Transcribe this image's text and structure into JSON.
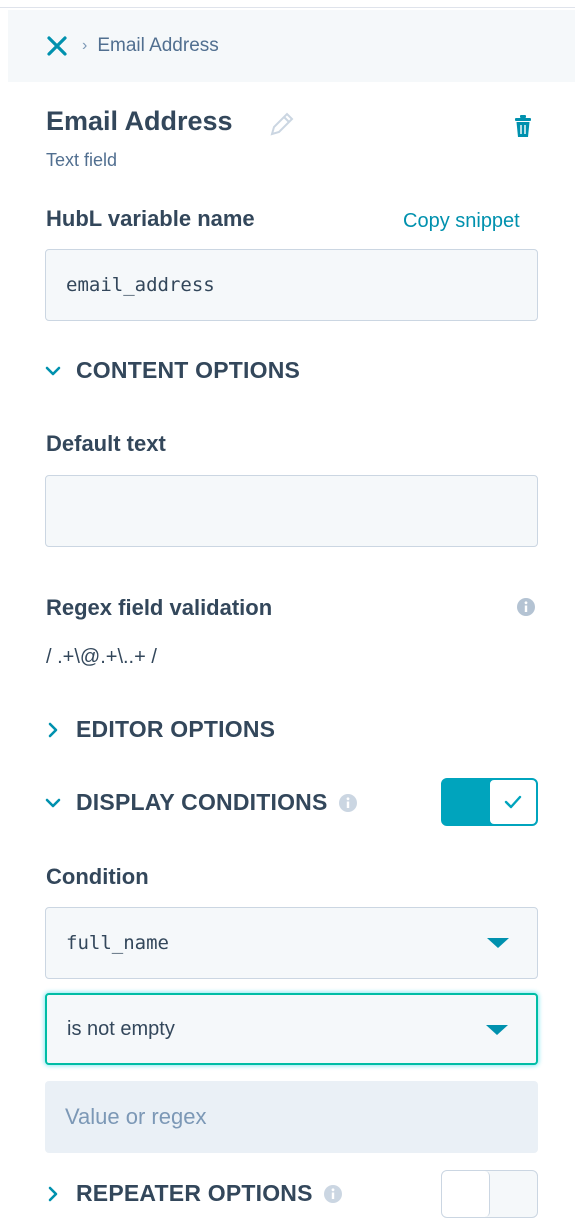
{
  "breadcrumb": {
    "current": "Email Address"
  },
  "header": {
    "title": "Email Address",
    "subtitle": "Text field"
  },
  "hubl": {
    "label": "HubL variable name",
    "copy_link": "Copy snippet",
    "value": "email_address"
  },
  "content_options": {
    "heading": "CONTENT OPTIONS",
    "default_text_label": "Default text",
    "default_text_value": "",
    "regex_label": "Regex field validation",
    "regex_value": "/ .+\\@.+\\..+ /"
  },
  "editor_options": {
    "heading": "EDITOR OPTIONS"
  },
  "display_conditions": {
    "heading": "DISPLAY CONDITIONS",
    "enabled": true,
    "condition_label": "Condition",
    "field": "full_name",
    "operator": "is not empty",
    "value_placeholder": "Value or regex"
  },
  "repeater_options": {
    "heading": "REPEATER OPTIONS",
    "enabled": false
  },
  "colors": {
    "accent": "#00a4bd",
    "link": "#0091ae",
    "text": "#33475b",
    "focus": "#00bda5"
  }
}
